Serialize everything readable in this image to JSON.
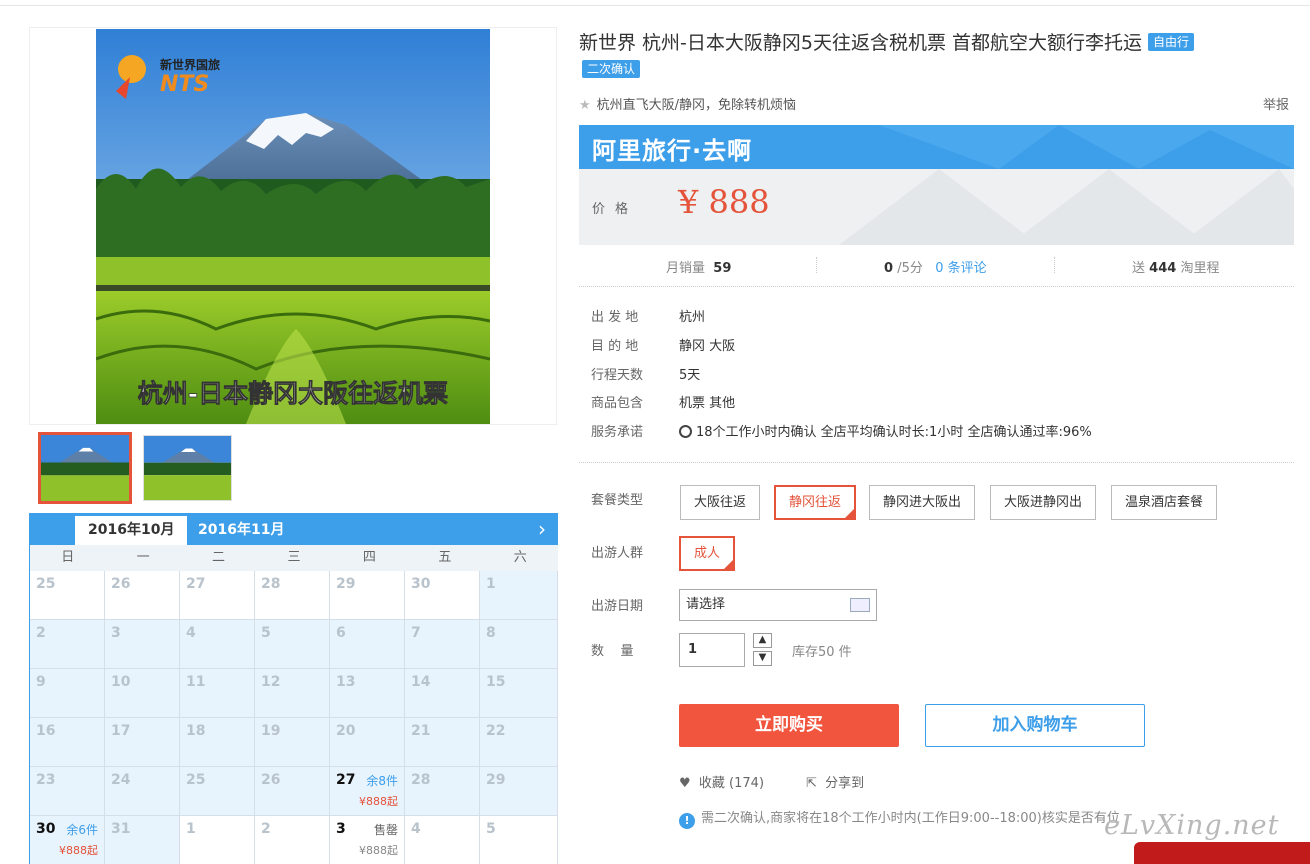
{
  "gallery": {
    "logo_cn": "新世界国旅",
    "logo_en": "NTS",
    "image_caption": "杭州-日本静冈大阪往返机票"
  },
  "calendar": {
    "tabs": [
      "2016年10月",
      "2016年11月"
    ],
    "next_label": "›",
    "weekdays": [
      "日",
      "一",
      "二",
      "三",
      "四",
      "五",
      "六"
    ],
    "rows": [
      [
        {
          "d": "25",
          "out": true
        },
        {
          "d": "26",
          "out": true
        },
        {
          "d": "27",
          "out": true
        },
        {
          "d": "28",
          "out": true
        },
        {
          "d": "29",
          "out": true
        },
        {
          "d": "30",
          "out": true
        },
        {
          "d": "1"
        }
      ],
      [
        {
          "d": "2"
        },
        {
          "d": "3"
        },
        {
          "d": "4"
        },
        {
          "d": "5"
        },
        {
          "d": "6"
        },
        {
          "d": "7"
        },
        {
          "d": "8"
        }
      ],
      [
        {
          "d": "9"
        },
        {
          "d": "10"
        },
        {
          "d": "11"
        },
        {
          "d": "12"
        },
        {
          "d": "13"
        },
        {
          "d": "14"
        },
        {
          "d": "15"
        }
      ],
      [
        {
          "d": "16"
        },
        {
          "d": "17"
        },
        {
          "d": "18"
        },
        {
          "d": "19"
        },
        {
          "d": "20"
        },
        {
          "d": "21"
        },
        {
          "d": "22"
        }
      ],
      [
        {
          "d": "23"
        },
        {
          "d": "24"
        },
        {
          "d": "25"
        },
        {
          "d": "26"
        },
        {
          "d": "27",
          "stock": "余8件",
          "price": "¥888起"
        },
        {
          "d": "28"
        },
        {
          "d": "29"
        }
      ],
      [
        {
          "d": "30",
          "stock": "余6件",
          "price": "¥888起"
        },
        {
          "d": "31"
        },
        {
          "d": "1",
          "out": true
        },
        {
          "d": "2",
          "out": true
        },
        {
          "d": "3",
          "out": true,
          "stock": "售罄",
          "sold": true,
          "price": "¥888起"
        },
        {
          "d": "4",
          "out": true
        },
        {
          "d": "5",
          "out": true
        }
      ]
    ]
  },
  "product": {
    "title": "新世界 杭州-日本大阪静冈5天往返含税机票 首都航空大额行李托运",
    "tag_free": "自由行",
    "tag_confirm": "二次确认",
    "subtitle": "杭州直飞大阪/静冈，免除转机烦恼",
    "report": "举报",
    "brand": "阿里旅行·去啊",
    "price_label": "价格",
    "price": "¥ 888"
  },
  "stats": {
    "sales_label": "月销量",
    "sales": "59",
    "score": "0",
    "score_unit": "/5分",
    "reviews": "0 条评论",
    "points_pre": "送",
    "points": "444",
    "points_post": "淘里程"
  },
  "info": [
    {
      "k": "出 发 地",
      "v": "杭州"
    },
    {
      "k": "目 的 地",
      "v": "静冈   大阪"
    },
    {
      "k": "行程天数",
      "v": "5天"
    },
    {
      "k": "商品包含",
      "v": "机票   其他"
    },
    {
      "k": "服务承诺",
      "v": "18个工作小时内确认    全店平均确认时长:1小时    全店确认通过率:96%"
    }
  ],
  "options": {
    "package_label": "套餐类型",
    "packages": [
      "大阪往返",
      "静冈往返",
      "静冈进大阪出",
      "大阪进静冈出",
      "温泉酒店套餐"
    ],
    "crowd_label": "出游人群",
    "crowd": "成人",
    "date_label": "出游日期",
    "date_value": "请选择",
    "qty_label": "数    量",
    "qty_value": "1",
    "stock": "库存50 件"
  },
  "actions": {
    "buy": "立即购买",
    "cart": "加入购物车",
    "fav": "收藏 (174)",
    "share": "分享到",
    "notice": "需二次确认,商家将在18个工作小时内(工作日9:00--18:00)核实是否有位"
  },
  "watermark": "eLvXing.net",
  "colors": {
    "accent": "#3d9ee9",
    "price": "#e4533a",
    "buy": "#f2553e"
  }
}
